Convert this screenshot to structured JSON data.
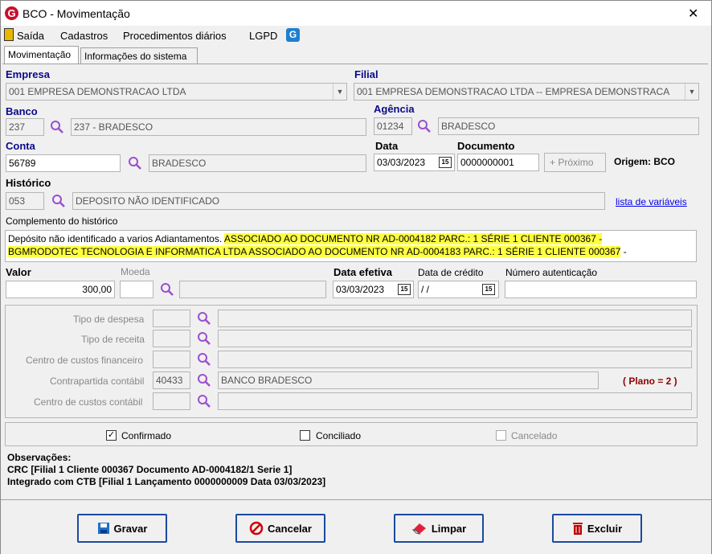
{
  "window": {
    "title": "BCO - Movimentação",
    "logo": "G"
  },
  "menu": {
    "items": [
      "Saída",
      "Cadastros",
      "Procedimentos diários",
      "LGPD"
    ]
  },
  "tabs": [
    "Movimentação",
    "Informações do sistema"
  ],
  "form": {
    "empresa_label": "Empresa",
    "empresa_value": "001 EMPRESA DEMONSTRACAO LTDA",
    "filial_label": "Filial",
    "filial_value": "001 EMPRESA DEMONSTRACAO LTDA -- EMPRESA DEMONSTRACA",
    "banco_label": "Banco",
    "banco_code": "237",
    "banco_name": "237 - BRADESCO",
    "agencia_label": "Agência",
    "agencia_code": "01234",
    "agencia_name": "BRADESCO",
    "conta_label": "Conta",
    "conta_code": "56789",
    "conta_name": "BRADESCO",
    "data_label": "Data",
    "data_value": "03/03/2023",
    "documento_label": "Documento",
    "documento_value": "0000000001",
    "proximo_label": "Próximo",
    "origem_label": "Origem: BCO",
    "historico_label": "Histórico",
    "historico_code": "053",
    "historico_name": "DEPOSITO NÃO IDENTIFICADO",
    "lista_label": "lista de variáveis",
    "complemento_label": "Complemento do histórico",
    "complemento_plain": "Depósito não identificado a varios Adiantamentos.",
    "complemento_hl1": "ASSOCIADO AO DOCUMENTO NR AD-0004182 PARC.: 1 SÉRIE 1 CLIENTE 000367 -",
    "complemento_hl2": "BGMRODOTEC TECNOLOGIA E INFORMATICA LTDA ASSOCIADO AO DOCUMENTO NR AD-0004183 PARC.: 1 SÉRIE 1 CLIENTE 000367",
    "complemento_tail": " -",
    "valor_label": "Valor",
    "valor_value": "300,00",
    "moeda_label": "Moeda",
    "data_efetiva_label": "Data efetiva",
    "data_efetiva_value": "03/03/2023",
    "data_credito_label": "Data de crédito",
    "data_credito_value": " / /",
    "numero_aut_label": "Número autenticação",
    "tipo_despesa_label": "Tipo de despesa",
    "tipo_receita_label": "Tipo de receita",
    "centro_fin_label": "Centro de custos financeiro",
    "contrapartida_label": "Contrapartida contábil",
    "contrapartida_code": "40433",
    "contrapartida_name": "BANCO BRADESCO",
    "plano_label": "( Plano = 2 )",
    "centro_cont_label": "Centro de custos contábil",
    "confirmado_label": "Confirmado",
    "conciliado_label": "Conciliado",
    "cancelado_label": "Cancelado",
    "obs_title": "Observações:",
    "obs_line1": "CRC [Filial 1 Cliente 000367 Documento AD-0004182/1 Serie 1]",
    "obs_line2": "Integrado com CTB [Filial 1 Lançamento 0000000009 Data 03/03/2023]",
    "cal_icon": "15"
  },
  "buttons": {
    "gravar": "Gravar",
    "cancelar": "Cancelar",
    "limpar": "Limpar",
    "excluir": "Excluir"
  },
  "colors": {
    "label_blue": "#0a0a8a",
    "plano_red": "#8b0000",
    "highlight": "#ffff40",
    "button_border": "#1a4aa0"
  }
}
